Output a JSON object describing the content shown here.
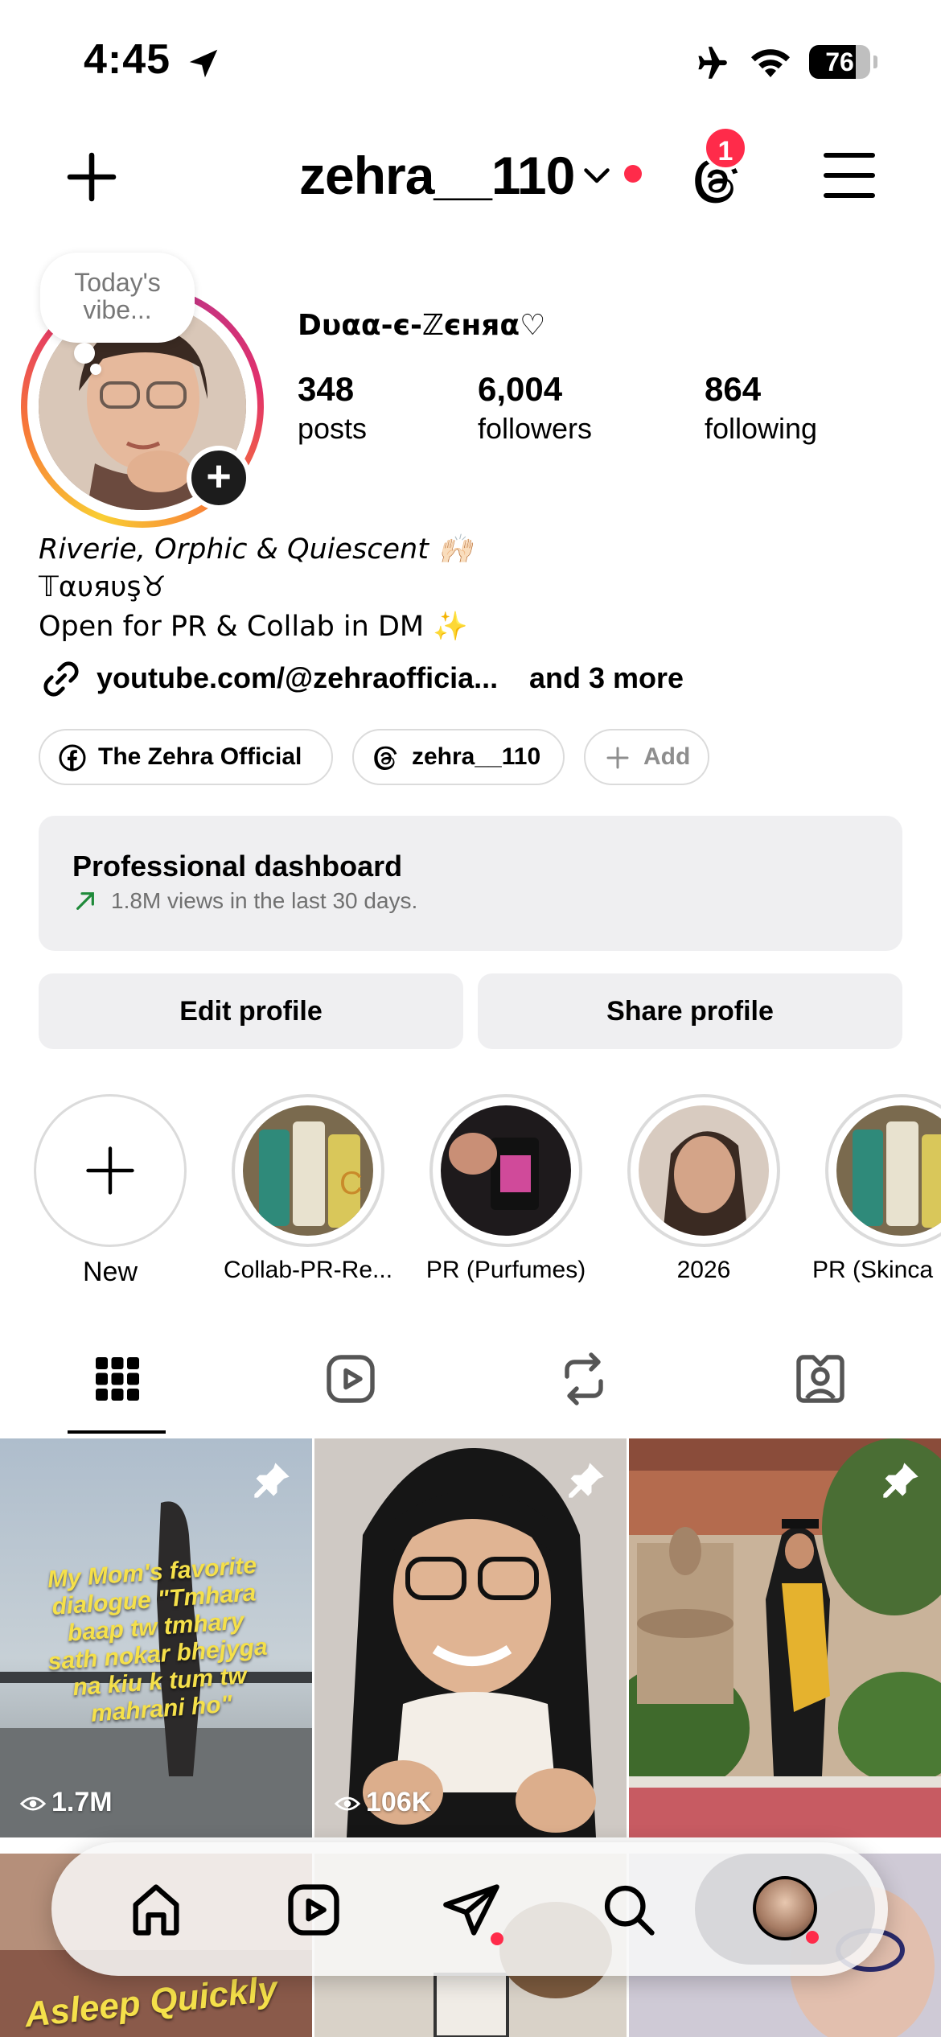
{
  "status_bar": {
    "time": "4:45",
    "battery": "76",
    "battery_fraction": 0.76
  },
  "header": {
    "username": "zehra__110",
    "notification_count": "1"
  },
  "profile": {
    "story_note": "Today's vibe...",
    "display_name": "Dυαα-є-ℤєняα♡",
    "stats": [
      {
        "value": "348",
        "label": "posts"
      },
      {
        "value": "6,004",
        "label": "followers"
      },
      {
        "value": "864",
        "label": "following"
      }
    ],
    "bio": [
      "Riverie, Orphic & Quiescent 🙌🏻",
      "𝕋αυяυş♉",
      "Open for PR & Collab in DM ✨"
    ],
    "link": "youtube.com/@zehraofficia...",
    "link_more": "and 3 more",
    "chips": [
      {
        "label": "The Zehra Official",
        "icon": "facebook-icon"
      },
      {
        "label": "zehra__110",
        "icon": "threads-icon"
      },
      {
        "label": "Add",
        "icon": "plus-icon"
      }
    ]
  },
  "dashboard": {
    "title": "Professional dashboard",
    "subtitle": "1.8M views in the last 30 days."
  },
  "buttons": {
    "edit": "Edit profile",
    "share": "Share profile"
  },
  "highlights": [
    {
      "label": "New"
    },
    {
      "label": "Collab-PR-Re..."
    },
    {
      "label": "PR (Purfumes)"
    },
    {
      "label": "2026"
    },
    {
      "label": "PR (Skinca"
    }
  ],
  "tabs": [
    "grid-icon",
    "reels-icon",
    "reposts-icon",
    "tagged-icon"
  ],
  "posts": [
    {
      "views": "1.7M",
      "overlay": "My Mom's favorite dialogue \"Tmhara baap tw tmhary sath nokar bhejyga na kiu k tum tw mahrani ho\""
    },
    {
      "views": "106K"
    },
    {
      "views": ""
    }
  ],
  "second_row_text": "Asleep Quickly",
  "colors": {
    "accent_red": "#ff2b4a",
    "chip_border": "#dbdbdb",
    "panel_bg": "#efeff1"
  }
}
